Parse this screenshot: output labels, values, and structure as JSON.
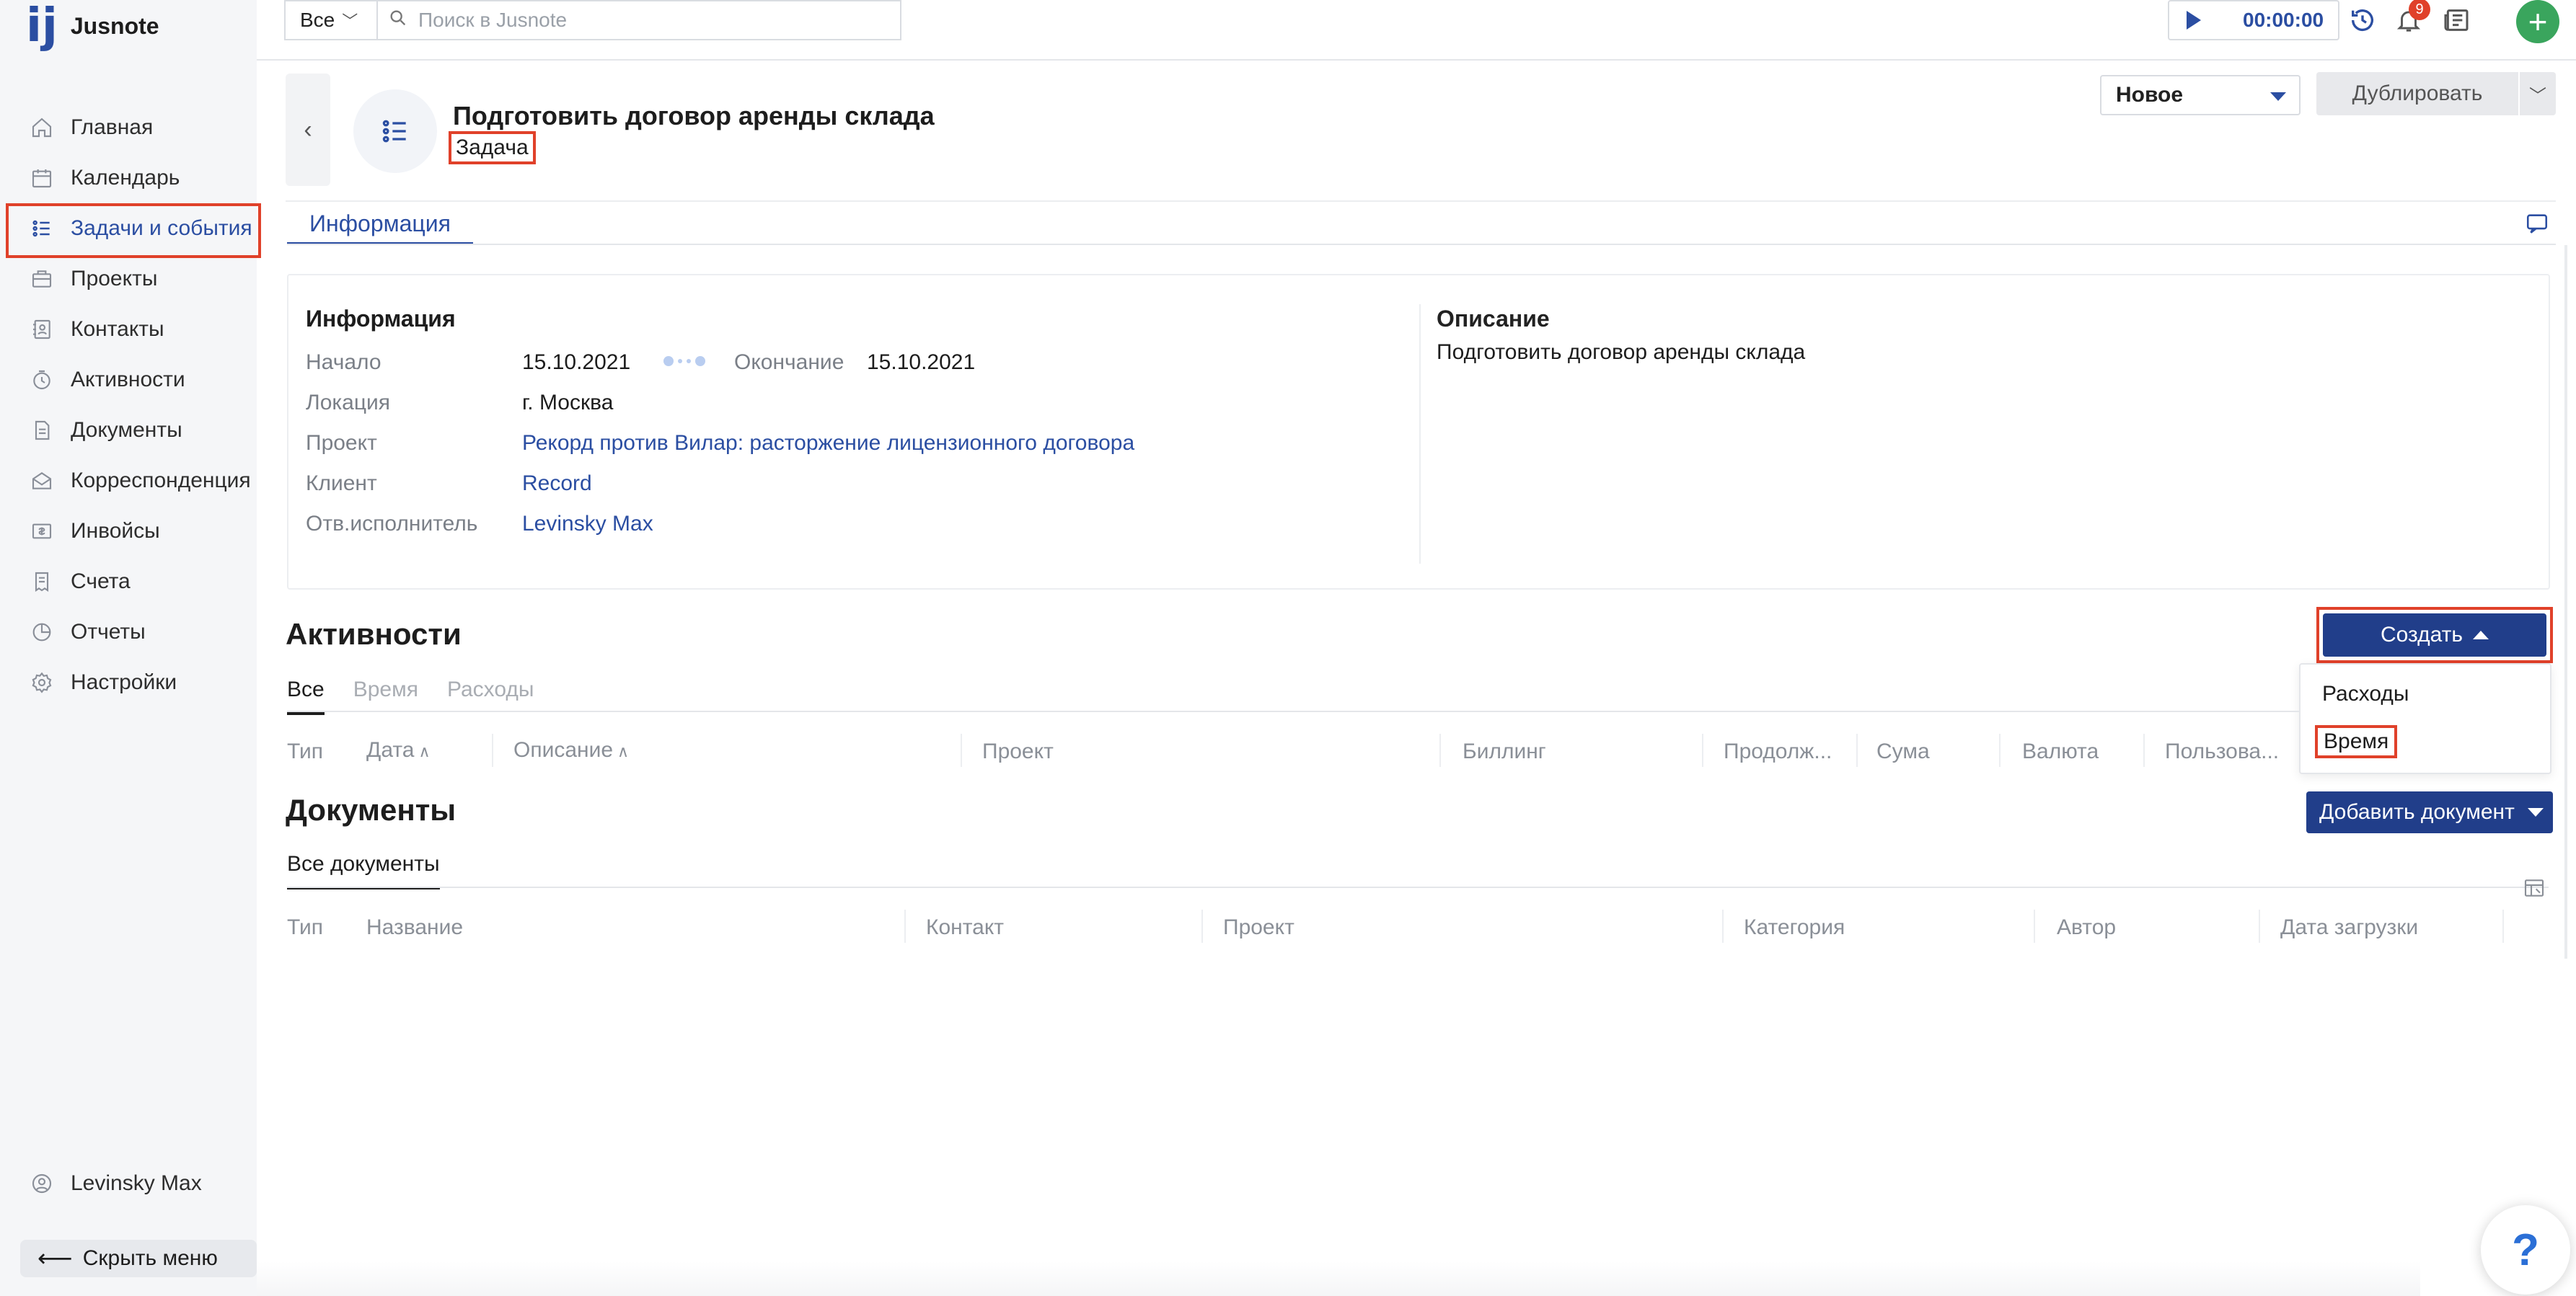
{
  "app": {
    "name": "Jusnote"
  },
  "sidebar": {
    "items": [
      {
        "label": "Главная",
        "icon": "home-icon"
      },
      {
        "label": "Календарь",
        "icon": "calendar-icon"
      },
      {
        "label": "Задачи и события",
        "icon": "tasks-icon",
        "active": true
      },
      {
        "label": "Проекты",
        "icon": "projects-icon"
      },
      {
        "label": "Контакты",
        "icon": "contacts-icon"
      },
      {
        "label": "Активности",
        "icon": "activities-icon"
      },
      {
        "label": "Документы",
        "icon": "documents-icon"
      },
      {
        "label": "Корреспонденция",
        "icon": "correspondence-icon"
      },
      {
        "label": "Инвойсы",
        "icon": "invoices-icon"
      },
      {
        "label": "Счета",
        "icon": "accounts-icon"
      },
      {
        "label": "Отчеты",
        "icon": "reports-icon"
      },
      {
        "label": "Настройки",
        "icon": "settings-icon"
      }
    ],
    "user": "Levinsky Max",
    "hide_menu": "Скрыть меню"
  },
  "topbar": {
    "scope": "Все",
    "search_placeholder": "Поиск в Jusnote",
    "timer": "00:00:00",
    "notifications_count": "9"
  },
  "task": {
    "title": "Подготовить договор аренды склада",
    "type": "Задача",
    "status": "Новое",
    "duplicate_label": "Дублировать"
  },
  "tabs": {
    "info": "Информация"
  },
  "info": {
    "heading": "Информация",
    "start_label": "Начало",
    "start_value": "15.10.2021",
    "end_label": "Окончание",
    "end_value": "15.10.2021",
    "location_label": "Локация",
    "location_value": "г. Москва",
    "project_label": "Проект",
    "project_value": "Рекорд против Вилар: расторжение лицензионного договора",
    "client_label": "Клиент",
    "client_value": "Record",
    "assignee_label": "Отв.исполнитель",
    "assignee_value": "Levinsky Max",
    "description_heading": "Описание",
    "description_text": "Подготовить договор аренды склада"
  },
  "activities": {
    "heading": "Активности",
    "create_label": "Создать",
    "dropdown": {
      "expenses": "Расходы",
      "time": "Время"
    },
    "subtabs": {
      "all": "Все",
      "time": "Время",
      "expenses": "Расходы"
    },
    "columns": {
      "type": "Тип",
      "date": "Дата",
      "description": "Описание",
      "project": "Проект",
      "billing": "Биллинг",
      "duration": "Продолж...",
      "sum": "Сума",
      "currency": "Валюта",
      "user": "Пользова..."
    }
  },
  "documents": {
    "heading": "Документы",
    "add_label": "Добавить документ",
    "tab_all": "Все документы",
    "columns": {
      "type": "Тип",
      "name": "Название",
      "contact": "Контакт",
      "project": "Проект",
      "category": "Категория",
      "author": "Автор",
      "upload_date": "Дата загрузки"
    }
  },
  "help": {
    "label": "?"
  },
  "colors": {
    "accent": "#2b4ea2",
    "primary_button": "#213e8a",
    "highlight": "#e0412a",
    "add": "#3aa55d"
  }
}
